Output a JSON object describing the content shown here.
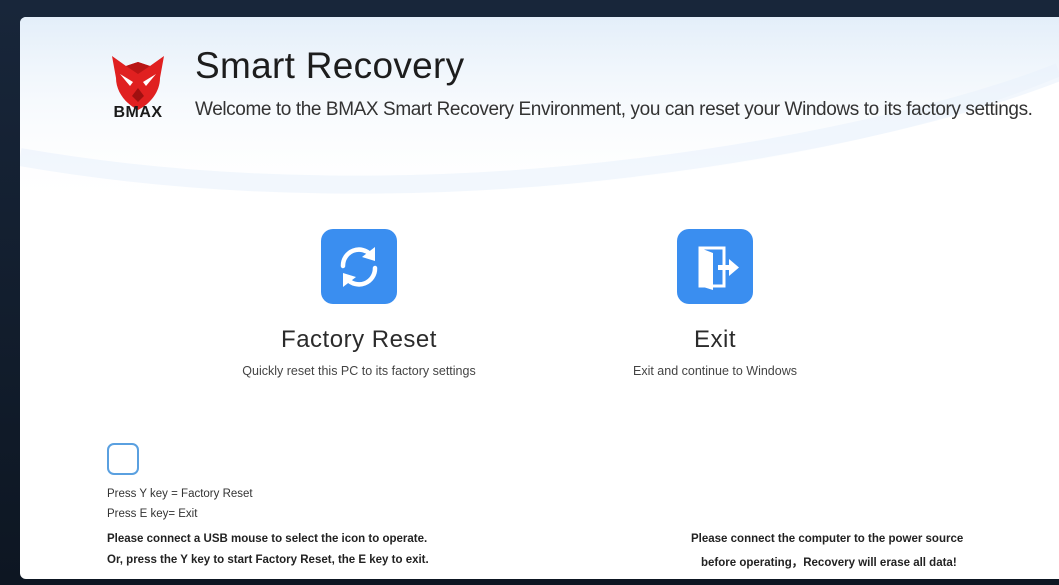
{
  "header": {
    "brand": "BMAX",
    "title": "Smart Recovery",
    "subtitle": "Welcome to the BMAX Smart Recovery Environment, you can reset your Windows to its factory settings."
  },
  "options": {
    "factory_reset": {
      "icon": "refresh-icon",
      "title": "Factory Reset",
      "description": "Quickly reset this PC to its factory settings"
    },
    "exit": {
      "icon": "exit-door-icon",
      "title": "Exit",
      "description": "Exit and continue to Windows"
    }
  },
  "key_hints": {
    "y_key": "Press  Y key = Factory Reset",
    "e_key": "Press  E key= Exit"
  },
  "notes": {
    "left_line1": "Please connect a USB mouse to select the icon to operate.",
    "left_line2": "Or, press the Y key to start Factory Reset, the E key to exit.",
    "right_line1": "Please connect the computer to the power source",
    "right_line2": "before operating，Recovery will erase all data!"
  },
  "colors": {
    "accent": "#3a8ef0",
    "logo_red": "#e02020",
    "checkbox_border": "#5aa0e0"
  }
}
